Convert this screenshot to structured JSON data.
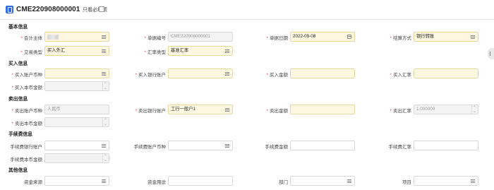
{
  "header": {
    "doc_number": "CME220908000001",
    "only_required_label": "只看必填项"
  },
  "sections": {
    "basic": "基本信息",
    "buy": "买入信息",
    "sell": "卖出信息",
    "fee": "手续费信息",
    "other": "其他信息"
  },
  "basic": {
    "entity_label": "会计主体",
    "doc_no_label": "单据编号",
    "doc_no_value": "CME220908000001",
    "doc_date_label": "单据日期",
    "doc_date_value": "2022-09-08",
    "settle_label": "结算方式",
    "settle_value": "银行转账",
    "trade_type_label": "交易类型",
    "trade_type_value": "买入外汇",
    "rate_type_label": "汇率类型",
    "rate_type_value": "基准汇率"
  },
  "buy": {
    "currency_label": "买入账户币种",
    "bank_label": "买入银行账户",
    "amount_label": "买入金额",
    "rate_label": "买入汇率",
    "local_label": "买入本币金额"
  },
  "sell": {
    "currency_label": "卖出账户币种",
    "currency_value": "人民币",
    "bank_label": "卖出银行账户",
    "bank_value": "工行一般户1",
    "amount_label": "卖出金额",
    "rate_label": "卖出汇率",
    "rate_value": "1.000000",
    "local_label": "卖出本币金额"
  },
  "fee": {
    "bank_label": "手续费银行账户",
    "currency_label": "手续费账户币种",
    "amount_label": "手续费金额",
    "rate_label": "手续费汇率",
    "local_label": "手续费本币金额"
  },
  "other": {
    "fund_source_label": "资金来源",
    "fund_use_label": "资金用途",
    "dept_label": "部门",
    "project_label": "项目"
  }
}
